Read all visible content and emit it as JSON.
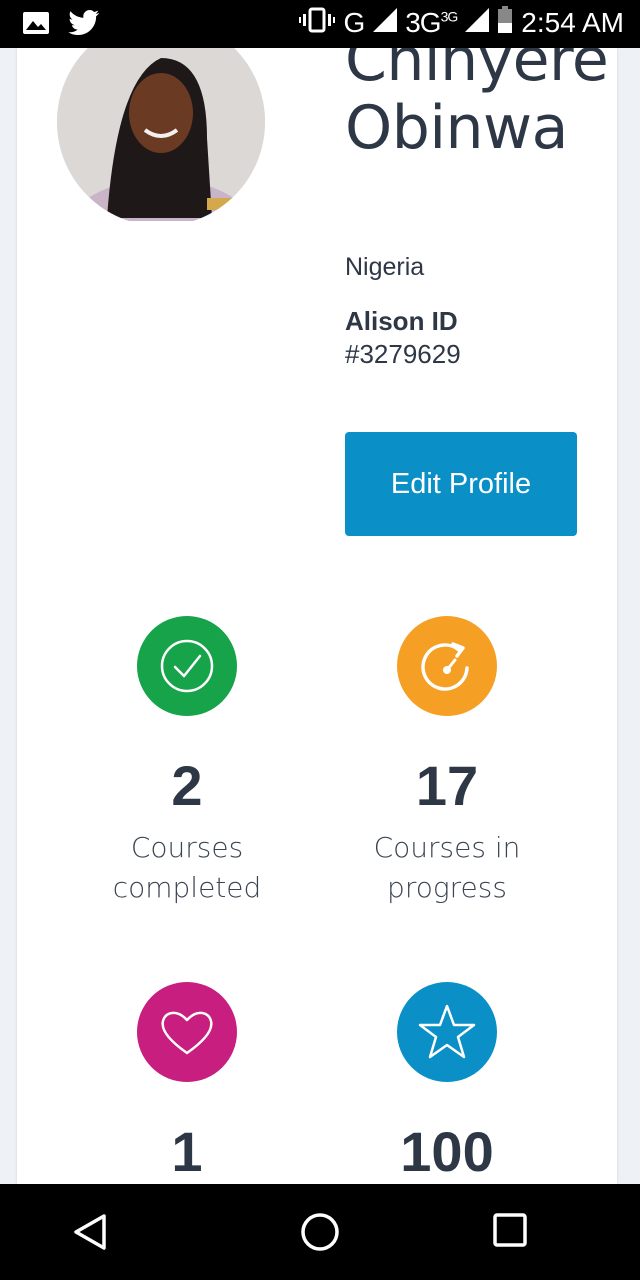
{
  "status_bar": {
    "time": "2:54 AM",
    "network_g": "G",
    "network_3g": "3G",
    "network_3g_sup": "3G",
    "icons": [
      "image-icon",
      "twitter-icon",
      "vibrate-icon",
      "signal-icon",
      "signal-icon",
      "battery-icon"
    ]
  },
  "profile": {
    "name": "Chinyere Obinwa",
    "country": "Nigeria",
    "id_label": "Alison ID",
    "id_value": "#3279629",
    "edit_button": "Edit Profile"
  },
  "stats": [
    {
      "value": "2",
      "label": "Courses completed",
      "icon": "check-circle-icon",
      "color": "#16a34a"
    },
    {
      "value": "17",
      "label": "Courses in progress",
      "icon": "progress-dial-icon",
      "color": "#f5a025"
    },
    {
      "value": "1",
      "label": "",
      "icon": "heart-icon",
      "color": "#c81e7f"
    },
    {
      "value": "100",
      "label": "",
      "icon": "star-icon",
      "color": "#0a8fc7"
    }
  ],
  "nav": [
    "back-icon",
    "home-icon",
    "recents-icon"
  ]
}
